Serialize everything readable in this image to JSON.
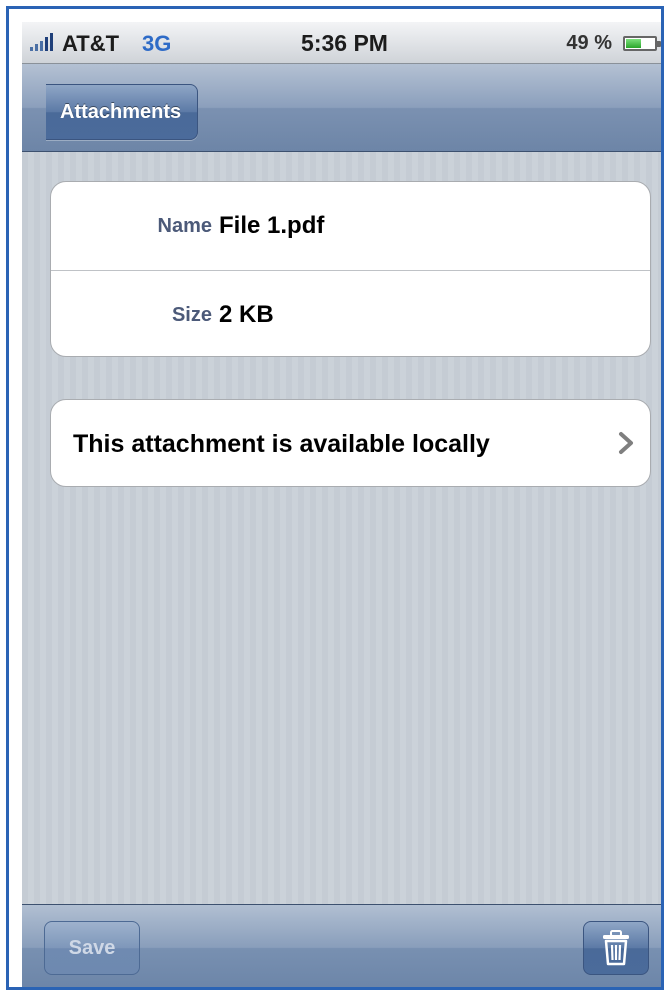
{
  "status_bar": {
    "carrier": "AT&T",
    "network": "3G",
    "time": "5:36 PM",
    "battery_percent": "49 %",
    "battery_level": 0.49,
    "signal_icon": "signal-bars-icon",
    "battery_icon": "battery-icon"
  },
  "nav": {
    "back_label": "Attachments"
  },
  "details": {
    "name_label": "Name",
    "name_value": "File 1.pdf",
    "size_label": "Size",
    "size_value": "2 KB"
  },
  "local": {
    "text": "This attachment is available locally",
    "icon": "chevron-right-icon"
  },
  "toolbar": {
    "save_label": "Save",
    "trash_icon": "trash-icon"
  },
  "colors": {
    "nav_bar": "#7b91b1",
    "label_text": "#4c5a79",
    "network_text": "#2e6bc7",
    "frame_border": "#2a63b5"
  }
}
